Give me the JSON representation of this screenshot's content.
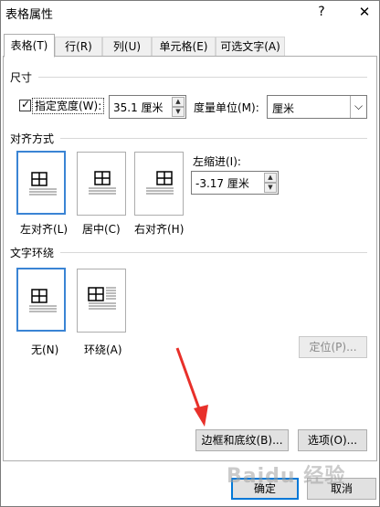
{
  "window": {
    "title": "表格属性",
    "help": "?",
    "close": "✕"
  },
  "tabs": [
    {
      "label": "表格(T)",
      "active": true
    },
    {
      "label": "行(R)",
      "active": false
    },
    {
      "label": "列(U)",
      "active": false
    },
    {
      "label": "单元格(E)",
      "active": false
    },
    {
      "label": "可选文字(A)",
      "active": false
    }
  ],
  "size": {
    "heading": "尺寸",
    "specify_width_label": "指定宽度(W):",
    "width_value": "35.1 厘米",
    "unit_label": "度量单位(M):",
    "unit_value": "厘米",
    "checked": true
  },
  "alignment": {
    "heading": "对齐方式",
    "options": [
      "左对齐(L)",
      "居中(C)",
      "右对齐(H)"
    ],
    "selected_index": 0,
    "indent_label": "左缩进(I):",
    "indent_value": "-3.17 厘米"
  },
  "wrapping": {
    "heading": "文字环绕",
    "options": [
      "无(N)",
      "环绕(A)"
    ],
    "selected_index": 0,
    "position_button": "定位(P)..."
  },
  "buttons": {
    "borders_shading": "边框和底纹(B)...",
    "options": "选项(O)...",
    "ok": "确定",
    "cancel": "取消"
  },
  "watermark": "Baidu 经验",
  "colors": {
    "accent": "#0078d7",
    "selected_tile": "#3a84d4",
    "arrow": "#e8302a"
  }
}
